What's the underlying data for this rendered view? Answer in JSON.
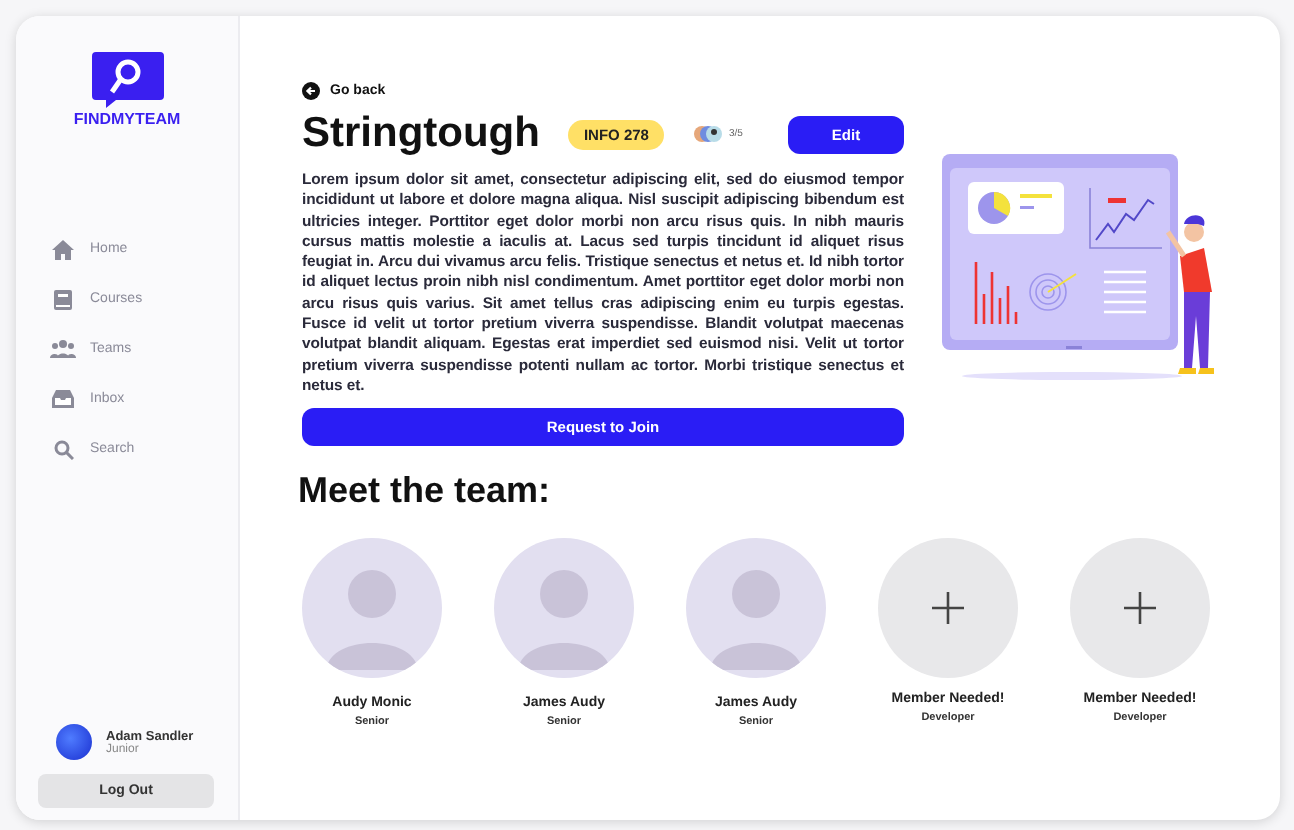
{
  "brand": {
    "name": "FINDMYTEAM"
  },
  "nav": [
    {
      "label": "Home",
      "kind": "home"
    },
    {
      "label": "Courses",
      "kind": "book"
    },
    {
      "label": "Teams",
      "kind": "people"
    },
    {
      "label": "Inbox",
      "kind": "inbox"
    },
    {
      "label": "Search",
      "kind": "search"
    }
  ],
  "user": {
    "name": "Adam Sandler",
    "role": "Junior"
  },
  "logout": "Log Out",
  "back": "Go back",
  "team": {
    "name": "Stringtough",
    "badge": "INFO 278",
    "count": "3/5",
    "edit": "Edit"
  },
  "description": "Lorem ipsum dolor sit amet, consectetur adipiscing elit, sed do eiusmod tempor incididunt ut labore et dolore magna aliqua. Nisl suscipit adipiscing bibendum est ultricies integer. Porttitor eget dolor morbi non arcu risus quis. In nibh mauris cursus mattis molestie a iaculis at. Lacus sed turpis tincidunt id aliquet risus feugiat in. Arcu dui vivamus arcu felis. Tristique senectus et netus et. Id nibh tortor id aliquet lectus proin nibh nisl condimentum. Amet porttitor eget dolor morbi non arcu risus quis varius. Sit amet tellus cras adipiscing enim eu turpis egestas. Fusce id velit ut tortor pretium viverra suspendisse. Blandit volutpat maecenas volutpat blandit aliquam. Egestas erat imperdiet sed euismod nisi. Velit ut tortor pretium viverra suspendisse potenti nullam ac tortor. Morbi tristique senectus et netus et.",
  "join": "Request to Join",
  "members_title": "Meet the team:",
  "members": [
    {
      "kind": "member",
      "name": "Audy Monic",
      "role": "Senior"
    },
    {
      "kind": "member",
      "name": "James Audy",
      "role": "Senior"
    },
    {
      "kind": "member",
      "name": "James Audy",
      "role": "Senior"
    },
    {
      "kind": "open",
      "name": "Member Needed!",
      "role": "Developer"
    },
    {
      "kind": "open",
      "name": "Member Needed!",
      "role": "Developer"
    }
  ]
}
